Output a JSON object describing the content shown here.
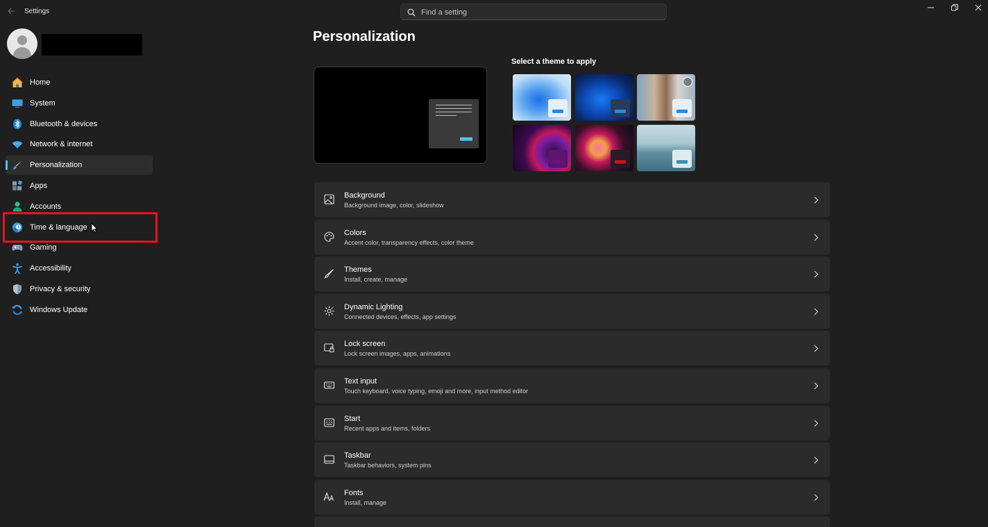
{
  "titlebar": {
    "app_title": "Settings",
    "search_placeholder": "Find a setting"
  },
  "nav": {
    "items": [
      {
        "label": "Home",
        "icon": "home-icon"
      },
      {
        "label": "System",
        "icon": "system-icon"
      },
      {
        "label": "Bluetooth & devices",
        "icon": "bluetooth-icon"
      },
      {
        "label": "Network & internet",
        "icon": "wifi-icon"
      },
      {
        "label": "Personalization",
        "icon": "brush-icon",
        "selected": true
      },
      {
        "label": "Apps",
        "icon": "apps-icon"
      },
      {
        "label": "Accounts",
        "icon": "accounts-icon"
      },
      {
        "label": "Time & language",
        "icon": "time-language-icon"
      },
      {
        "label": "Gaming",
        "icon": "gamepad-icon"
      },
      {
        "label": "Accessibility",
        "icon": "accessibility-icon"
      },
      {
        "label": "Privacy & security",
        "icon": "shield-icon"
      },
      {
        "label": "Windows Update",
        "icon": "update-icon"
      }
    ]
  },
  "main": {
    "page_title": "Personalization",
    "themes_label": "Select a theme to apply",
    "cards": [
      {
        "title": "Background",
        "subtitle": "Background image, color, slideshow",
        "icon": "image-icon"
      },
      {
        "title": "Colors",
        "subtitle": "Accent color, transparency effects, color theme",
        "icon": "palette-icon"
      },
      {
        "title": "Themes",
        "subtitle": "Install, create, manage",
        "icon": "brush-icon"
      },
      {
        "title": "Dynamic Lighting",
        "subtitle": "Connected devices, effects, app settings",
        "icon": "lighting-icon"
      },
      {
        "title": "Lock screen",
        "subtitle": "Lock screen images, apps, animations",
        "icon": "lock-screen-icon"
      },
      {
        "title": "Text input",
        "subtitle": "Touch keyboard, voice typing, emoji and more, input method editor",
        "icon": "keyboard-icon"
      },
      {
        "title": "Start",
        "subtitle": "Recent apps and items, folders",
        "icon": "start-icon"
      },
      {
        "title": "Taskbar",
        "subtitle": "Taskbar behaviors, system pins",
        "icon": "taskbar-icon"
      },
      {
        "title": "Fonts",
        "subtitle": "Install, manage",
        "icon": "fonts-icon"
      }
    ]
  },
  "colors": {
    "accent": "#4cc2ff",
    "highlight_border": "#e8141b"
  }
}
